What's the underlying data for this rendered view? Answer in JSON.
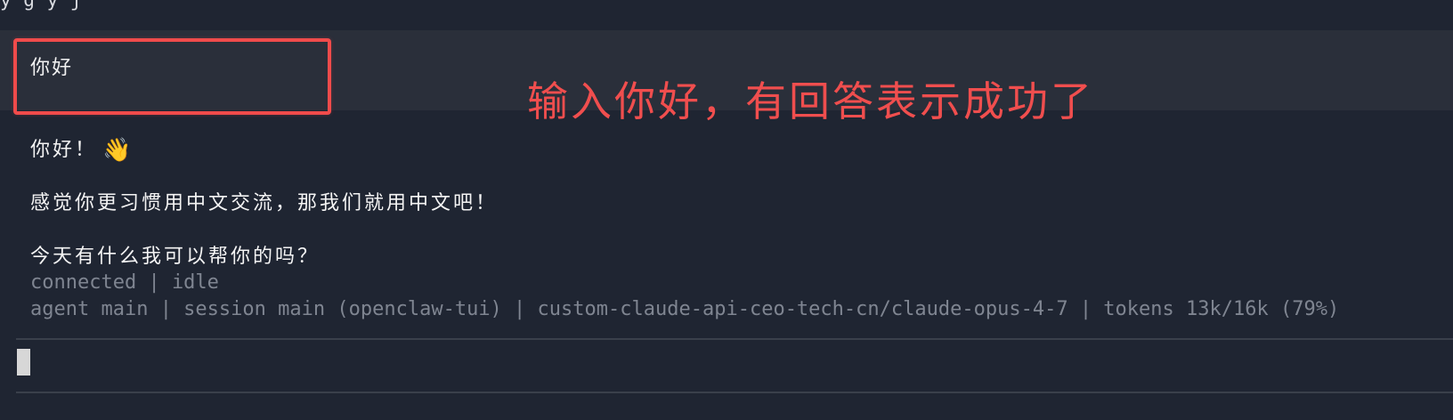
{
  "top_cut_text": "y      g y                                                                                                                      j",
  "user_message": {
    "text": "你好"
  },
  "annotation": {
    "text": "输入你好，有回答表示成功了",
    "color": "#f04e4e"
  },
  "reply": {
    "line1": "你好！",
    "line1_icon": "👋",
    "line2": "感觉你更习惯用中文交流，那我们就用中文吧！",
    "line3": "今天有什么我可以帮你的吗？"
  },
  "status": {
    "connection": "connected | idle",
    "details": "agent main | session main (openclaw-tui) | custom-claude-api-ceo-tech-cn/claude-opus-4-7 | tokens 13k/16k (79%)"
  },
  "colors": {
    "background": "#1f2532",
    "user_band": "#2a2f3a",
    "highlight": "#f04b4b",
    "muted_text": "#7f8591"
  },
  "icons": {
    "wave": "waving-hand-icon"
  }
}
